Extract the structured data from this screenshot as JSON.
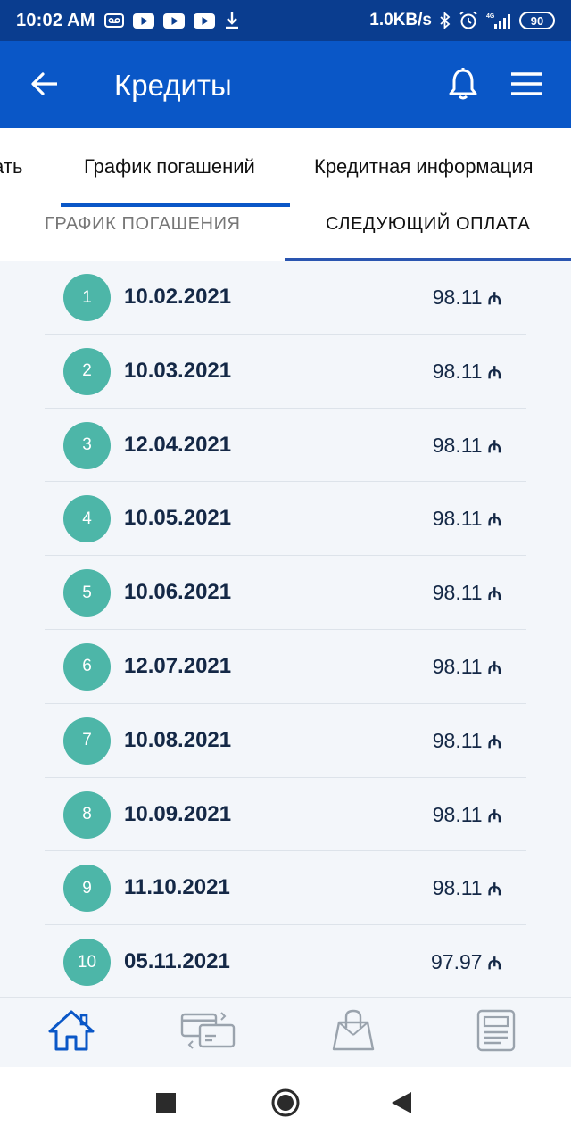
{
  "status_bar": {
    "time": "10:02 AM",
    "speed": "1.0KB/s",
    "network": "4G",
    "battery": "90",
    "icons": [
      "voicemail-icon",
      "youtube-icon",
      "youtube-icon",
      "youtube-icon",
      "download-icon",
      "bluetooth-icon",
      "alarm-icon",
      "signal-icon",
      "battery-icon"
    ]
  },
  "app_bar": {
    "title": "Кредиты",
    "back_icon": "arrow-left-icon",
    "notification_icon": "bell-icon",
    "menu_icon": "hamburger-menu-icon"
  },
  "tabs": {
    "partial": "нать",
    "schedule": "График погашений",
    "credit_info": "Кредитная информация",
    "active": "schedule"
  },
  "sub_tabs": {
    "schedule": "ГРАФИК ПОГАШЕНИЯ",
    "next_payment": "СЛЕДУЮЩИЙ ОПЛАТА",
    "active": "next_payment"
  },
  "payments": [
    {
      "n": "1",
      "date": "10.02.2021",
      "amount": "98.11",
      "currency": "₼"
    },
    {
      "n": "2",
      "date": "10.03.2021",
      "amount": "98.11",
      "currency": "₼"
    },
    {
      "n": "3",
      "date": "12.04.2021",
      "amount": "98.11",
      "currency": "₼"
    },
    {
      "n": "4",
      "date": "10.05.2021",
      "amount": "98.11",
      "currency": "₼"
    },
    {
      "n": "5",
      "date": "10.06.2021",
      "amount": "98.11",
      "currency": "₼"
    },
    {
      "n": "6",
      "date": "12.07.2021",
      "amount": "98.11",
      "currency": "₼"
    },
    {
      "n": "7",
      "date": "10.08.2021",
      "amount": "98.11",
      "currency": "₼"
    },
    {
      "n": "8",
      "date": "10.09.2021",
      "amount": "98.11",
      "currency": "₼"
    },
    {
      "n": "9",
      "date": "11.10.2021",
      "amount": "98.11",
      "currency": "₼"
    },
    {
      "n": "10",
      "date": "05.11.2021",
      "amount": "97.97",
      "currency": "₼"
    }
  ],
  "bottom_nav": {
    "items": [
      "home-icon",
      "transfers-icon",
      "shopping-bag-icon",
      "documents-icon"
    ],
    "active": "home-icon"
  },
  "colors": {
    "status_bar": "#0a3d8f",
    "app_bar": "#0a57c7",
    "circle": "#4db6a8",
    "text_dark": "#142846",
    "list_bg": "#f3f6fa"
  }
}
